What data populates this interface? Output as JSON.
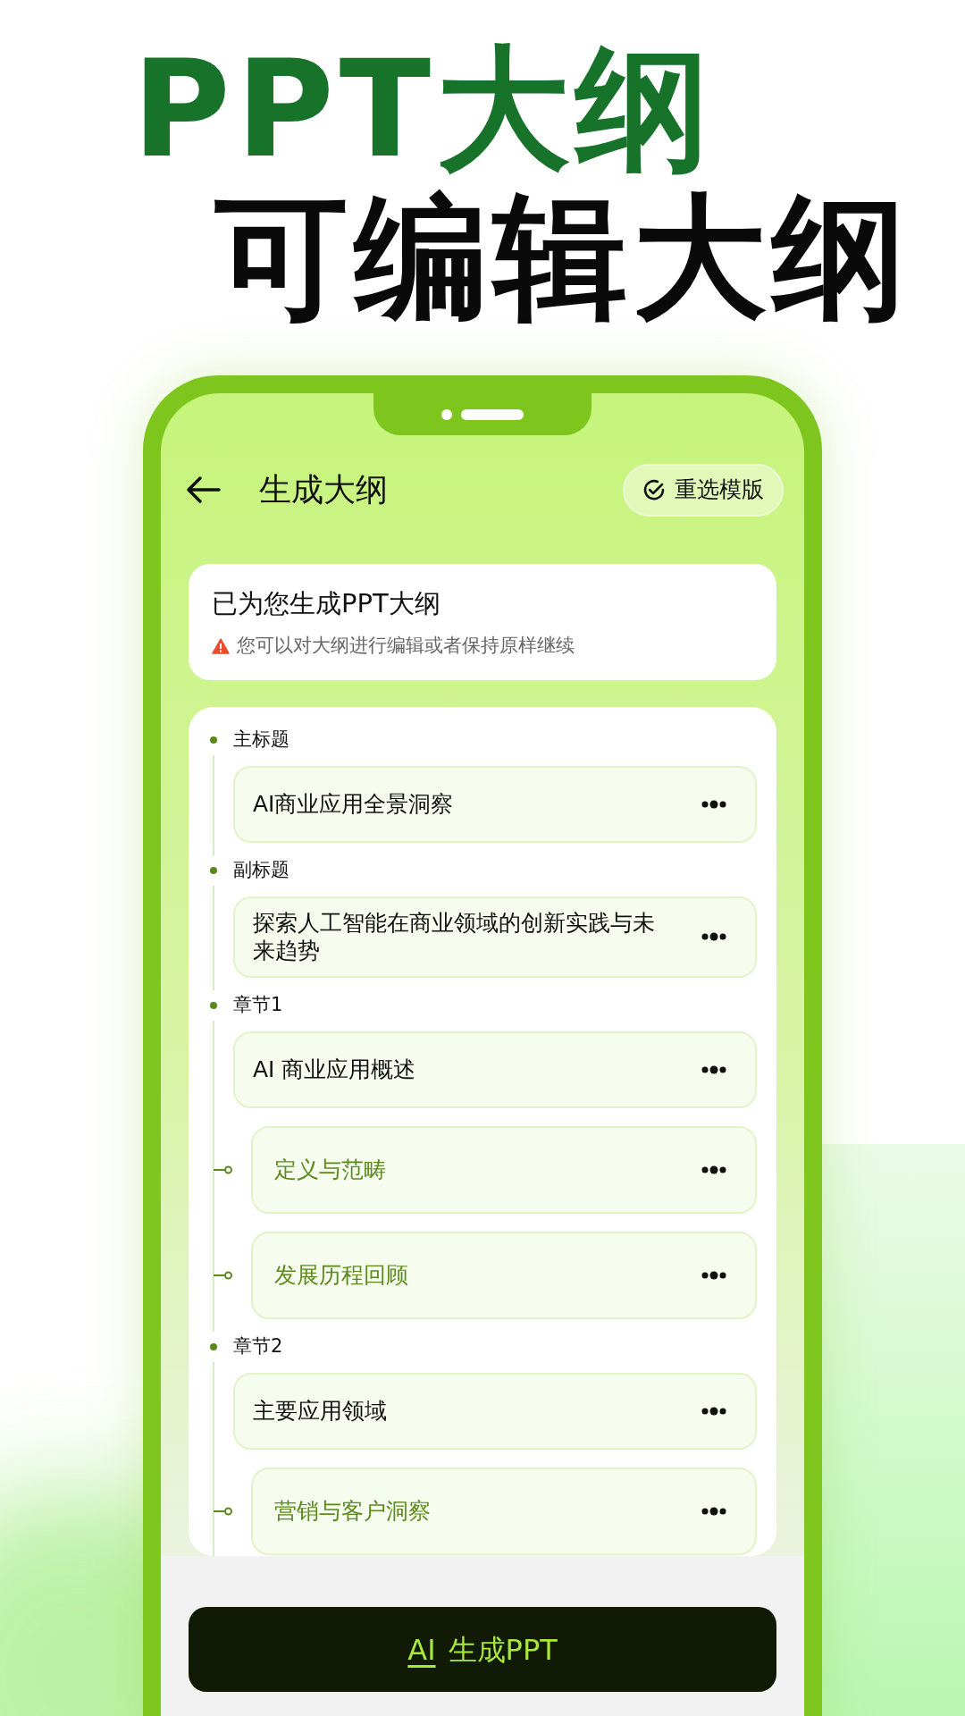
{
  "headline": {
    "line_1": "PPT大纲",
    "line_2": "可编辑大纲"
  },
  "header": {
    "title": "生成大纲",
    "action": "重选模版"
  },
  "notice": {
    "title": "已为您生成PPT大纲",
    "hint": "您可以对大纲进行编辑或者保持原样继续"
  },
  "outline": [
    {
      "label": "主标题",
      "items": [
        {
          "text": "AI商业应用全景洞察"
        }
      ]
    },
    {
      "label": "副标题",
      "items": [
        {
          "text": "探索人工智能在商业领域的创新实践与未来趋势"
        }
      ]
    },
    {
      "label": "章节1",
      "items": [
        {
          "text": "AI 商业应用概述",
          "children": [
            {
              "text": "定义与范畴"
            },
            {
              "text": "发展历程回顾"
            }
          ]
        }
      ]
    },
    {
      "label": "章节2",
      "items": [
        {
          "text": "主要应用领域",
          "children": [
            {
              "text": "营销与客户洞察"
            }
          ]
        }
      ]
    }
  ],
  "generate_button": {
    "icon_text": "AI",
    "label": "生成PPT"
  }
}
